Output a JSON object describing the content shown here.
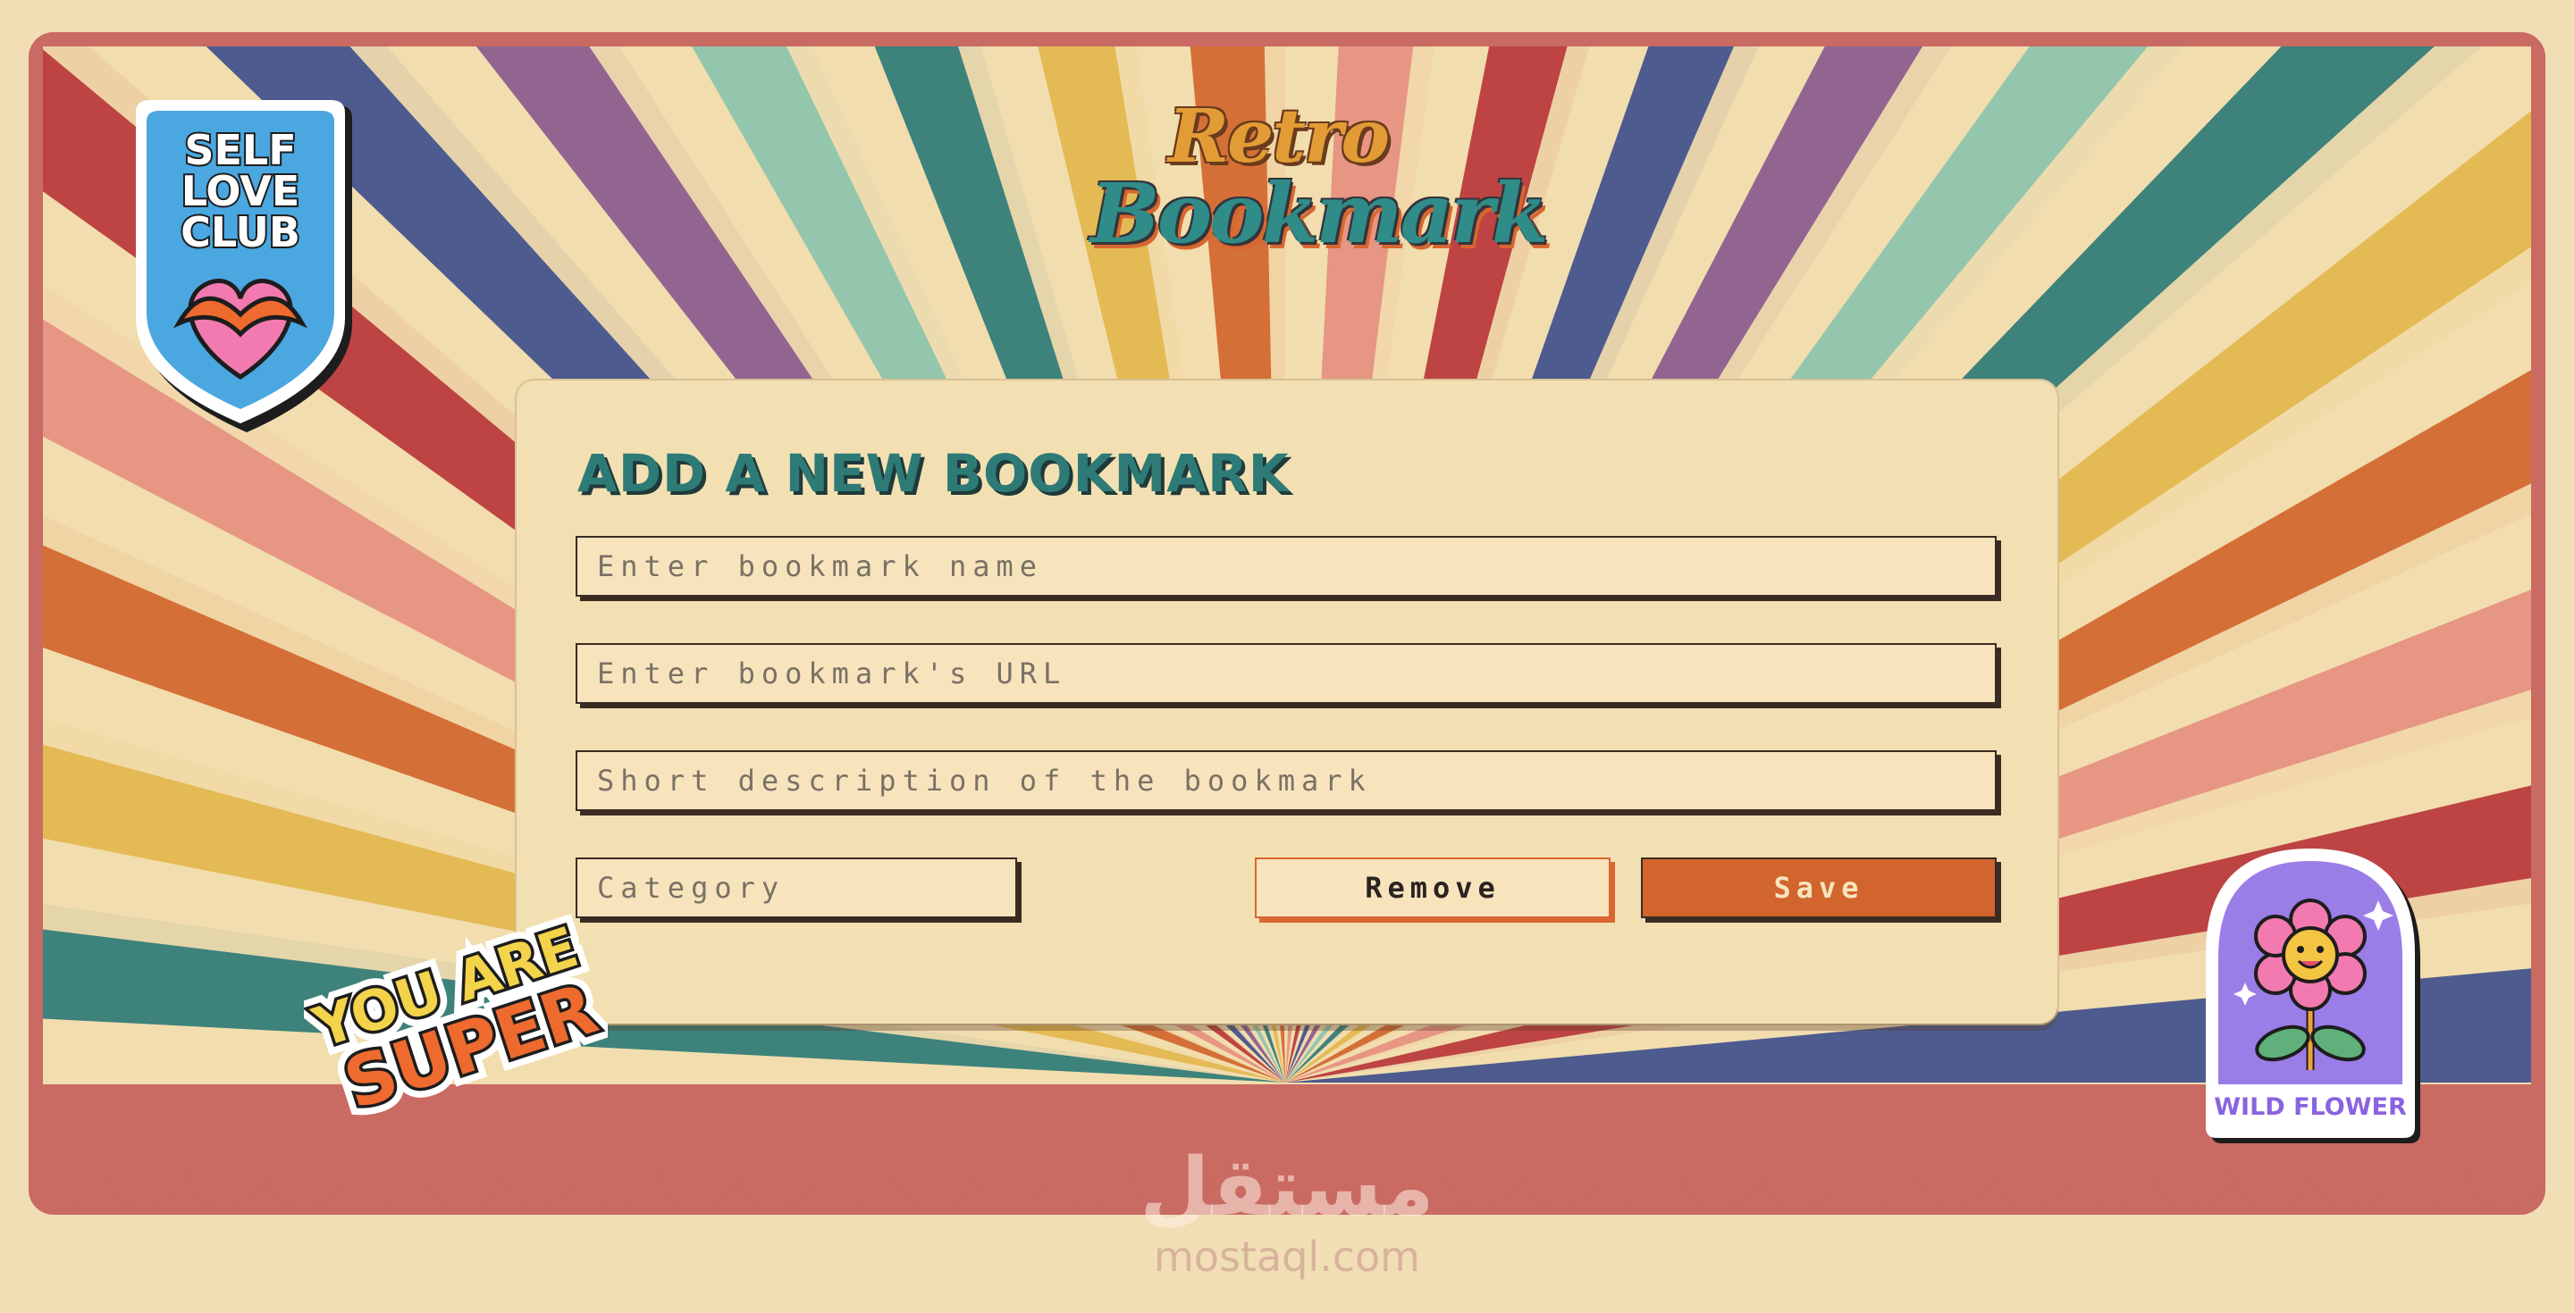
{
  "app": {
    "logo_line1": "Retro",
    "logo_line2": "Bookmark"
  },
  "form": {
    "title": "ADD A NEW BOOKMARK",
    "name_placeholder": "Enter bookmark name",
    "url_placeholder": "Enter bookmark's URL",
    "description_placeholder": "Short description of the bookmark",
    "category_placeholder": "Category",
    "remove_label": "Remove",
    "save_label": "Save"
  },
  "stickers": {
    "self_love": [
      "SELF",
      "LOVE",
      "CLUB"
    ],
    "you_are_super": [
      "YOU ARE",
      "SUPER"
    ],
    "wild_flower": "WILD FLOWER"
  },
  "watermark": {
    "arabic": "مستقل",
    "url": "mostaql.com"
  },
  "colors": {
    "teal": "#2e7a76",
    "orange": "#d1652d",
    "cream": "#f3e0b2",
    "brick": "#c96a63",
    "mustard": "#e3b64c",
    "navy": "#3f4f8c",
    "purple": "#8a5a8e",
    "red": "#b8363a"
  }
}
